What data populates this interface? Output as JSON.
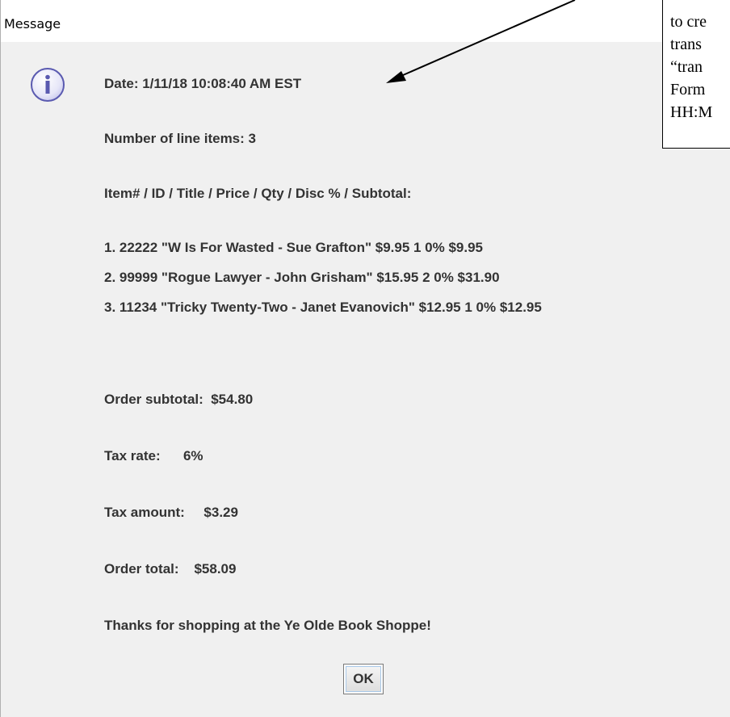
{
  "window": {
    "title": "Message"
  },
  "message": {
    "date": "Date: 1/11/18 10:08:40 AM EST",
    "line_item_count": "Number of line items: 3",
    "header": "Item# / ID / Title / Price / Qty / Disc % / Subtotal:",
    "items": [
      "1. 22222 \"W Is For Wasted - Sue Grafton\" $9.95 1 0% $9.95",
      "2. 99999 \"Rogue Lawyer - John Grisham\" $15.95 2 0% $31.90",
      "3. 11234 \"Tricky Twenty-Two - Janet Evanovich\" $12.95 1 0% $12.95"
    ],
    "subtotal": "Order subtotal:  $54.80",
    "tax_rate": "Tax rate:      6%",
    "tax_amount": "Tax amount:     $3.29",
    "total": "Order total:    $58.09",
    "thanks": "Thanks for shopping at the Ye Olde Book Shoppe!"
  },
  "buttons": {
    "ok_label": "OK"
  },
  "icons": {
    "info": "info-icon",
    "info_color": "#5a5ab0"
  },
  "annotation": {
    "lines": [
      "to cre",
      "trans",
      "“tran",
      "Form",
      "HH:M"
    ]
  }
}
